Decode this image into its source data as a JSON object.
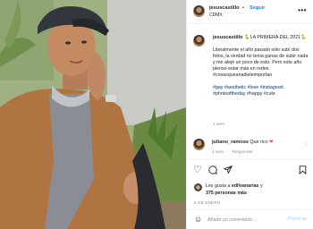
{
  "header": {
    "username": "jesuscastillo",
    "separator": "•",
    "follow_label": "Seguir",
    "location": "CDMX",
    "more_icon": "more-horizontal-icon"
  },
  "caption": {
    "username": "jesuscastillo",
    "title": "🐍LA PRIMERA DEL 2021🐍",
    "body": "Literalmente el año pasado solo subí dos fotos, la verdad no tenía ganas de subir nada y me alejé un poco de esto. Pero este año pienso estar más en redes. #cosasqueanadieleimportan",
    "hashtags": "#gay #aesthetic #love #instagood #photooftheday #happy #cute",
    "time": "1 sem"
  },
  "comment": {
    "username": "juliano_ramoss",
    "text": "Que rico",
    "heart": "❤",
    "time": "1 sem",
    "reply_label": "Responder"
  },
  "actions": {
    "like_icon": "heart-icon",
    "comment_icon": "comment-icon",
    "share_icon": "share-icon",
    "save_icon": "bookmark-icon"
  },
  "likes": {
    "prefix": "Les gusta a",
    "user": "edilvanarias",
    "mid": "y",
    "count": "375 personas más"
  },
  "date": "6 DE ENERO",
  "add_comment": {
    "emoji_icon": "emoji-icon",
    "placeholder": "Añade un comentario...",
    "publish_label": "Publicar"
  }
}
